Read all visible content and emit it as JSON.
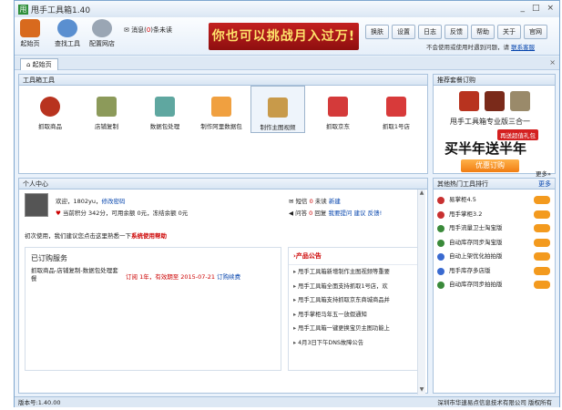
{
  "app": {
    "title": "甩手工具箱1.40",
    "version": "版本号:1.40.00",
    "company": "深圳市华速易点信息技术有限公司 版权所有"
  },
  "window": {
    "min": "_",
    "max": "□",
    "close": "×"
  },
  "toolbar": {
    "items": [
      {
        "label": "起始页",
        "icon": "home-icon"
      },
      {
        "label": "查找工具",
        "icon": "magnifier-icon"
      },
      {
        "label": "配置网店",
        "icon": "gear-icon"
      }
    ],
    "message_prefix": "消息(",
    "message_count": "0",
    "message_suffix": ")条未读",
    "banner": "你也可以挑战月入过万!",
    "buttons": [
      "换肤",
      "设置",
      "日志",
      "反馈",
      "帮助",
      "关于",
      "官网"
    ],
    "hint": "不会使用或使用时遇到问题，请",
    "hint_link": "联系客服"
  },
  "tab": {
    "label": "起始页",
    "close": "×"
  },
  "tools_panel": {
    "title": "工具箱工具",
    "items": [
      "抓取商品",
      "店铺复制",
      "数据包处理",
      "制作阿里数据包",
      "制作主图视频",
      "抓取京东",
      "抓取1号店"
    ]
  },
  "recommend": {
    "title": "推荐套餐订购",
    "name": "甩手工具箱专业版三合一",
    "badge": "再送超值礼包",
    "slogan": "买半年送半年",
    "button": "优惠订购",
    "more": "更多»"
  },
  "personal": {
    "title": "个人中心",
    "welcome": "欢迎，1802yu",
    "change_pwd": "修改密码",
    "points": "当前积分 342分，可用余额 0元，冻结余额 0元",
    "sms_prefix": "短信 ",
    "sms_count": "0",
    "sms_suffix": " 未读",
    "sms_new": "新建",
    "qa_prefix": "问答 ",
    "qa_count": "0",
    "qa_suffix": " 回复",
    "qa_link": "我要提问 建议 反馈!",
    "tip": "初次使用，我们建议您点击这里熟悉一下",
    "tip_link": "系统使用帮助",
    "subscribed_title": "已订购服务",
    "sub_desc": "抓取商品-店铺复制-数据包处理套餐",
    "sub_order": "订阅 1年，有效期至 2015-07-21",
    "sub_renew": "订购续费"
  },
  "news": {
    "title": "›产品公告",
    "items": [
      "甩手工具箱新增制作主图视频等重要",
      "甩手工具箱全面支持抓取1号店，欢",
      "甩手工具箱支持抓取京东商城商品并",
      "甩手掌柜马年五一放假通知",
      "甩手工具箱一键更换宝贝主图功能上",
      "4月3日下午DNS故障公告"
    ]
  },
  "hot": {
    "title": "其他热门工具排行",
    "more": "更多",
    "items": [
      {
        "name": "易掌柜4.5",
        "color": "#c83030"
      },
      {
        "name": "甩手掌柜3.2",
        "color": "#c83030"
      },
      {
        "name": "甩手流量卫士淘宝版",
        "color": "#3a8a3a"
      },
      {
        "name": "自动库存同步淘宝版",
        "color": "#3a8a3a"
      },
      {
        "name": "自动上架优化拍拍版",
        "color": "#3a6ad0"
      },
      {
        "name": "甩手库存多店版",
        "color": "#3a6ad0"
      },
      {
        "name": "自动库存同步拍拍版",
        "color": "#3a8a3a"
      }
    ]
  }
}
